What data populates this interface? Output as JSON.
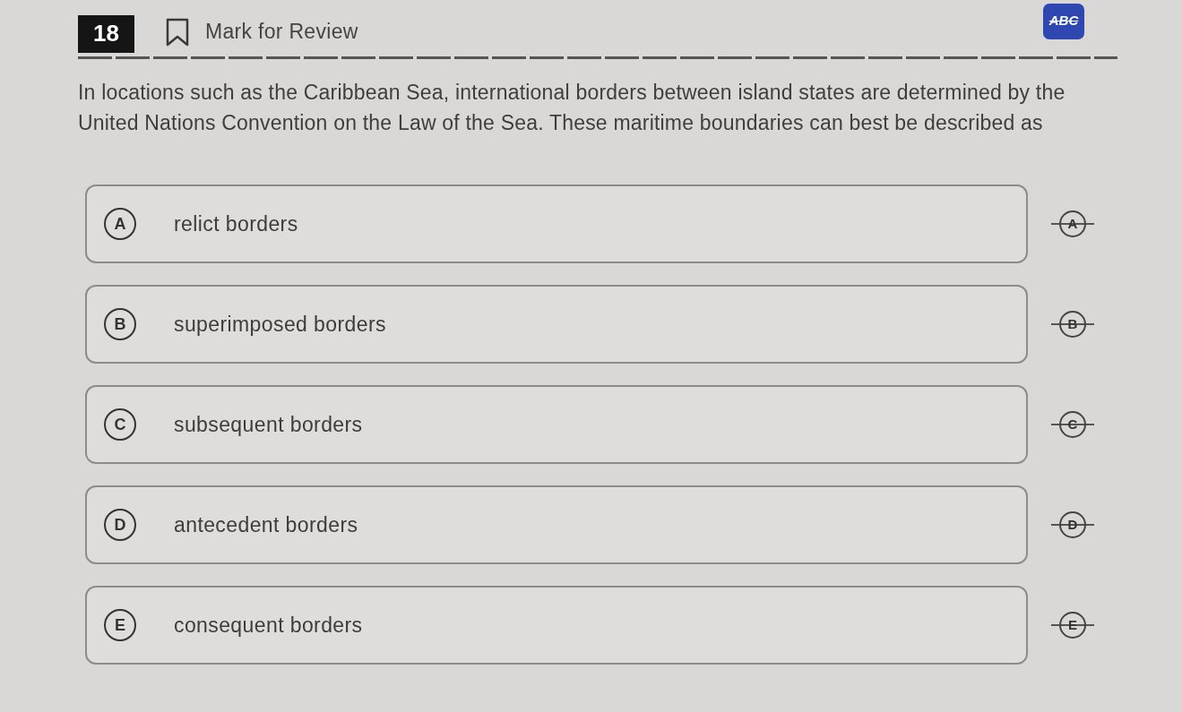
{
  "header": {
    "question_number": "18",
    "mark_for_review": {
      "label": "Mark for Review",
      "marked": false
    },
    "eliminator_tool": {
      "label": "ABC",
      "on": true
    }
  },
  "question": {
    "text": "In locations such as the Caribbean Sea, international borders between island states are determined by the United Nations Convention on the Law of the Sea. These maritime boundaries can best be described as"
  },
  "choices": [
    {
      "letter": "A",
      "text": "relict borders",
      "selected": false,
      "eliminator_letter": "A"
    },
    {
      "letter": "B",
      "text": "superimposed borders",
      "selected": false,
      "eliminator_letter": "B"
    },
    {
      "letter": "C",
      "text": "subsequent borders",
      "selected": false,
      "eliminator_letter": "C"
    },
    {
      "letter": "D",
      "text": "antecedent borders",
      "selected": false,
      "eliminator_letter": "D"
    },
    {
      "letter": "E",
      "text": "consequent borders",
      "selected": false,
      "eliminator_letter": "E"
    }
  ]
}
